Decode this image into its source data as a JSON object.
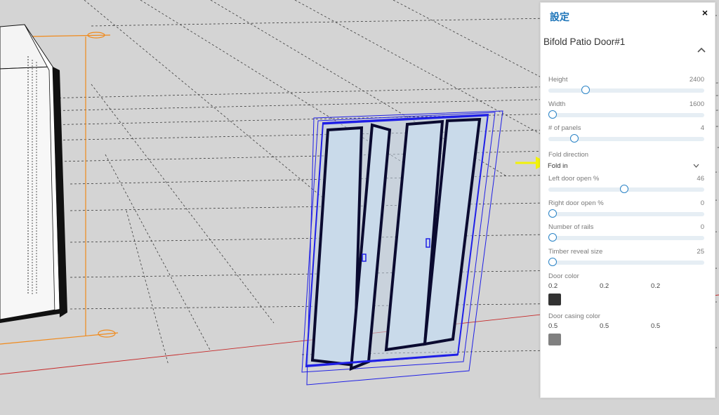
{
  "panel": {
    "title": "設定",
    "close_label": "×",
    "object_name": "Bifold Patio Door#1"
  },
  "params": [
    {
      "label": "Height",
      "value": "2400",
      "fraction": 0.21
    },
    {
      "label": "Width",
      "value": "1600",
      "fraction": 0.0
    },
    {
      "label": "# of panels",
      "value": "4",
      "fraction": 0.14
    },
    {
      "label": "Left door open %",
      "value": "46",
      "fraction": 0.46
    },
    {
      "label": "Right door open %",
      "value": "0",
      "fraction": 0.0
    },
    {
      "label": "Number of rails",
      "value": "0",
      "fraction": 0.0
    },
    {
      "label": "Timber reveal size",
      "value": "25",
      "fraction": 0.0
    }
  ],
  "fold_direction": {
    "label": "Fold direction",
    "value": "Fold in"
  },
  "door_color": {
    "label": "Door color",
    "r": "0.2",
    "g": "0.2",
    "b": "0.2",
    "swatch": "#333333"
  },
  "casing_color": {
    "label": "Door casing color",
    "r": "0.5",
    "g": "0.5",
    "b": "0.5",
    "swatch": "#808080"
  },
  "colors": {
    "accent": "#2a83c6",
    "selection": "#1f1fe6",
    "guide_orange": "#f08a1c",
    "red_axis": "#c62828",
    "arrow_yellow": "#f2f20a"
  }
}
